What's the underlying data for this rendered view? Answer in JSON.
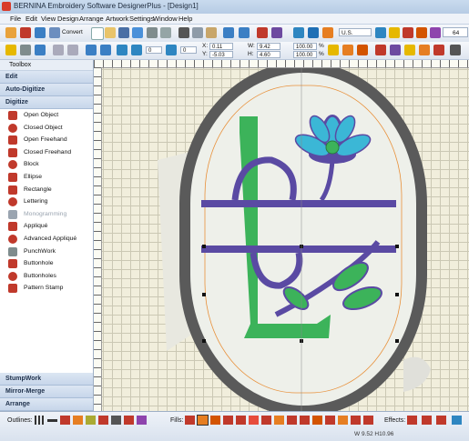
{
  "window": {
    "title": "BERNINA Embroidery Software DesignerPlus - [Design1]"
  },
  "menu": [
    "File",
    "Edit",
    "View",
    "Design",
    "Arrange",
    "Artwork",
    "Settings",
    "Window",
    "Help"
  ],
  "toolbar": {
    "convert_label": "Convert",
    "rotate_value": "0",
    "rotate_value2": "0",
    "x_label": "X:",
    "x_value": "0.11",
    "y_label": "Y:",
    "y_value": "-5.03",
    "w_label": "W:",
    "w_value": "9.42",
    "h_label": "H:",
    "h_value": "4.60",
    "pct_w": "100.00",
    "pct_h": "100.00",
    "unit": "%",
    "hoop": "U.S.",
    "zoom": "64"
  },
  "toolbox": {
    "title": "Toolbox",
    "sections_top": [
      "Edit",
      "Auto-Digitize",
      "Digitize"
    ],
    "items": [
      {
        "label": "Open Object",
        "icon": "open-object-icon",
        "color": "#c0392b"
      },
      {
        "label": "Closed Object",
        "icon": "closed-object-icon",
        "color": "#c0392b"
      },
      {
        "label": "Open Freehand",
        "icon": "open-freehand-icon",
        "color": "#c0392b"
      },
      {
        "label": "Closed Freehand",
        "icon": "closed-freehand-icon",
        "color": "#c0392b"
      },
      {
        "label": "Block",
        "icon": "block-icon",
        "color": "#c0392b"
      },
      {
        "label": "Ellipse",
        "icon": "ellipse-icon",
        "color": "#c0392b"
      },
      {
        "label": "Rectangle",
        "icon": "rectangle-icon",
        "color": "#c0392b"
      },
      {
        "label": "Lettering",
        "icon": "lettering-icon",
        "color": "#c0392b"
      },
      {
        "label": "Monogramming",
        "icon": "monogramming-icon",
        "color": "#9aa4b0",
        "disabled": true
      },
      {
        "label": "Appliqué",
        "icon": "applique-icon",
        "color": "#c0392b"
      },
      {
        "label": "Advanced Appliqué",
        "icon": "advanced-applique-icon",
        "color": "#c0392b"
      },
      {
        "label": "PunchWork",
        "icon": "punchwork-icon",
        "color": "#7f8c8d"
      },
      {
        "label": "Buttonhole",
        "icon": "buttonhole-icon",
        "color": "#c0392b"
      },
      {
        "label": "Buttonholes",
        "icon": "buttonholes-icon",
        "color": "#c0392b"
      },
      {
        "label": "Pattern Stamp",
        "icon": "pattern-stamp-icon",
        "color": "#c0392b"
      }
    ],
    "sections_bottom": [
      "StumpWork",
      "Mirror-Merge",
      "Arrange"
    ]
  },
  "status": {
    "outlines_label": "Outlines:",
    "fills_label": "Fills:",
    "effects_label": "Effects:",
    "dimensions": "W 9.52 H10.96"
  },
  "colors": {
    "hoop": "#5a5a5a",
    "hoop_inner": "#eef0ea",
    "guide": "#e8903a",
    "letter_green": "#3cb35a",
    "purple": "#5a4aa3",
    "flower_cyan": "#3bb7d6",
    "canvas_bg": "#f1eedc"
  }
}
